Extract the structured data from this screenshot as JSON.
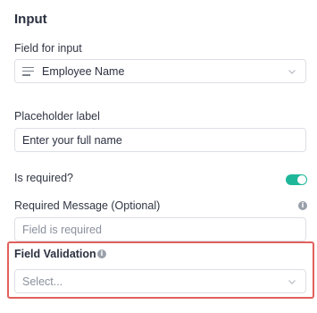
{
  "panel": {
    "title": "Input"
  },
  "field_for_input": {
    "label": "Field for input",
    "value": "Employee Name",
    "icon": "text-lines-icon"
  },
  "placeholder": {
    "label": "Placeholder label",
    "value": "Enter your full name"
  },
  "required": {
    "label": "Is required?",
    "enabled": true,
    "toggle_color": "#1fb79a"
  },
  "required_message": {
    "label": "Required Message (Optional)",
    "placeholder": "Field is required",
    "info_icon": "info-icon"
  },
  "field_validation": {
    "label": "Field Validation",
    "placeholder": "Select...",
    "info_icon": "info-icon",
    "highlight_color": "#e2605c"
  }
}
